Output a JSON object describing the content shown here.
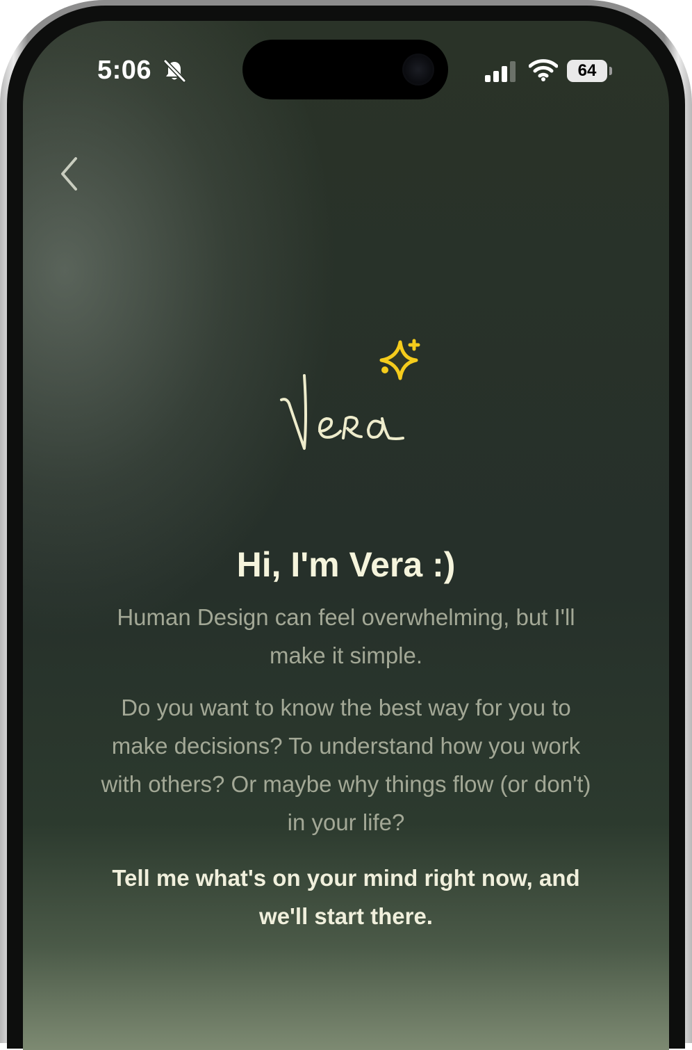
{
  "status_bar": {
    "time": "5:06",
    "battery": "64",
    "icons": [
      "bell-slash-icon",
      "cellular-signal-icon",
      "wifi-icon",
      "battery-icon"
    ]
  },
  "nav": {
    "back_icon": "chevron-left-icon"
  },
  "logo": {
    "text": "Vera",
    "icon": "sparkle-icon",
    "colors": {
      "logo": "#eeeccc",
      "sparkle": "#f5cc1c"
    }
  },
  "intro": {
    "title": "Hi, I'm Vera :)",
    "paragraph_1": "Human Design can feel overwhelming, but I'll make it simple.",
    "paragraph_2": "Do you want to know the best way for you to make decisions? To understand how you work with others? Or maybe why things flow (or don't) in your life?",
    "cta": "Tell me what's on your mind right now, and we'll start there."
  },
  "colors": {
    "background_top": "#2a3328",
    "background_bottom": "#7d8a72",
    "title": "#f5f4dc",
    "body_text": "#a3a896"
  }
}
